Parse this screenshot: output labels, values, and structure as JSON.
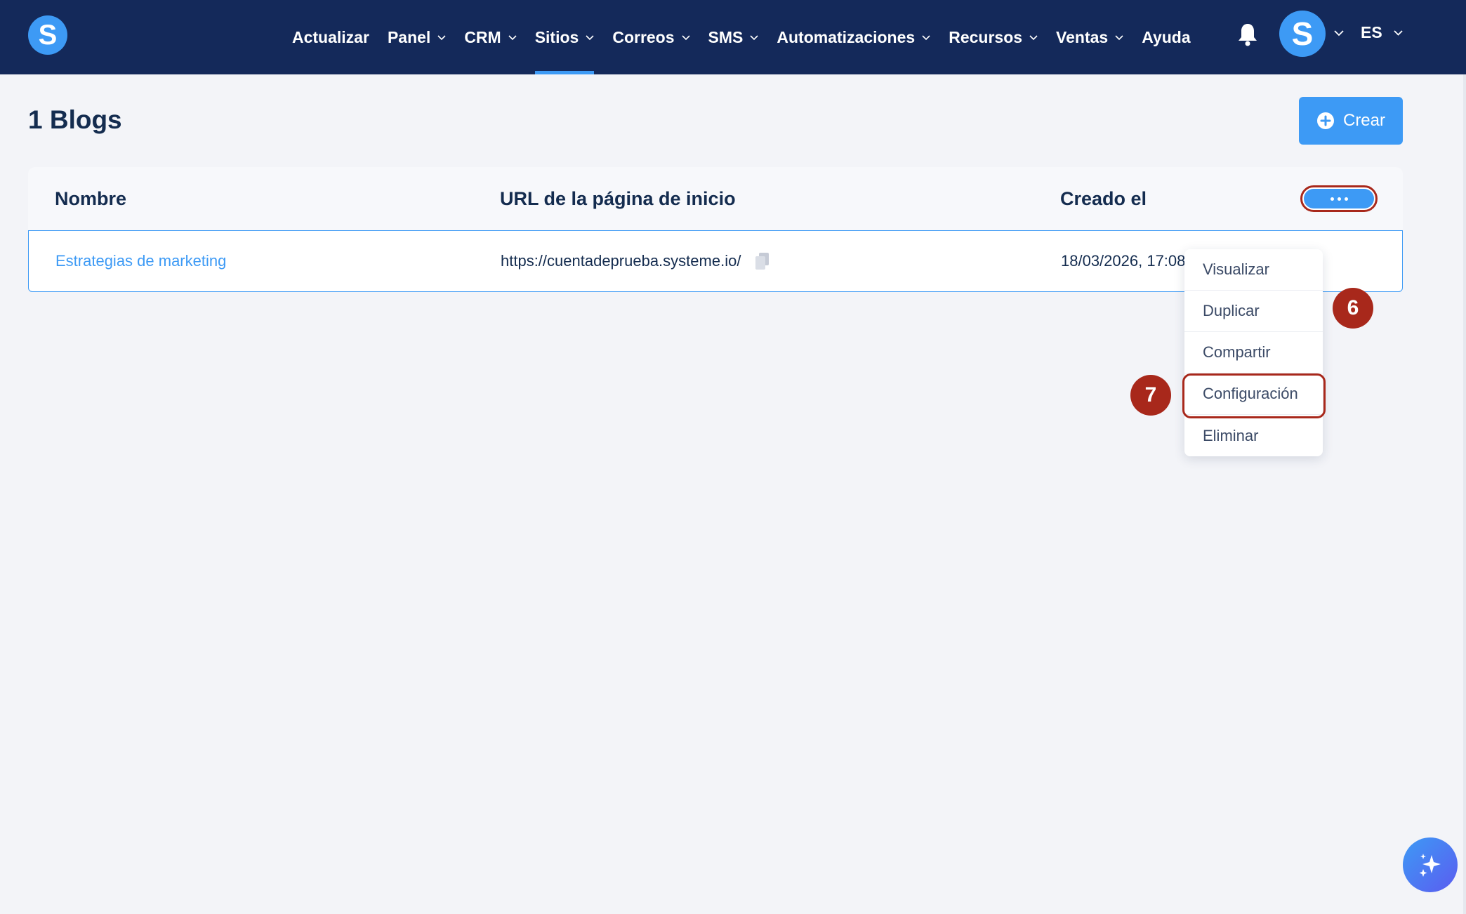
{
  "app": {
    "logo_letter": "S",
    "brand_color": "#3d9af5",
    "nav_bg": "#14295a"
  },
  "nav": {
    "items": [
      {
        "label": "Actualizar",
        "dropdown": false
      },
      {
        "label": "Panel",
        "dropdown": true
      },
      {
        "label": "CRM",
        "dropdown": true
      },
      {
        "label": "Sitios",
        "dropdown": true,
        "active": true
      },
      {
        "label": "Correos",
        "dropdown": true
      },
      {
        "label": "SMS",
        "dropdown": true
      },
      {
        "label": "Automatizaciones",
        "dropdown": true
      },
      {
        "label": "Recursos",
        "dropdown": true
      },
      {
        "label": "Ventas",
        "dropdown": true
      },
      {
        "label": "Ayuda",
        "dropdown": false
      }
    ],
    "notification_icon": "bell-icon",
    "avatar_letter": "S",
    "language": "ES"
  },
  "page": {
    "title": "1 Blogs",
    "create_label": "Crear"
  },
  "table": {
    "columns": [
      "Nombre",
      "URL de la página de inicio",
      "Creado el"
    ],
    "rows": [
      {
        "name": "Estrategias de marketing",
        "url": "https://cuentadeprueba.systeme.io/",
        "created": "18/03/2026, 17:08"
      }
    ]
  },
  "row_menu": {
    "items": [
      "Visualizar",
      "Duplicar",
      "Compartir",
      "Configuración",
      "Eliminar"
    ],
    "highlighted": "Configuración"
  },
  "annotations": {
    "step_more": "6",
    "step_config": "7",
    "color": "#a8281b"
  }
}
